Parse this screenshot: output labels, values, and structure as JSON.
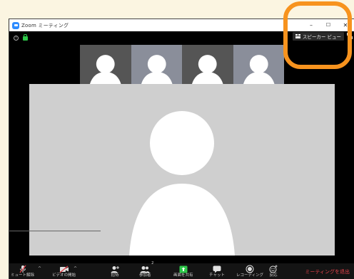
{
  "window": {
    "title": "Zoom ミーティング",
    "minimize_glyph": "–",
    "maximize_glyph": "☐",
    "close_glyph": "✕"
  },
  "header": {
    "info_glyph": "i",
    "speaker_view_label": "スピーカー ビュー"
  },
  "participants": {
    "thumbnails": [
      {
        "bg": "#555555"
      },
      {
        "bg": "#8a8e9a"
      },
      {
        "bg": "#555555"
      },
      {
        "bg": "#8a8e9a"
      }
    ],
    "main_bg": "#cfcfcf"
  },
  "toolbar": {
    "mute_label": "ミュート解除",
    "video_label": "ビデオの開始",
    "invite_label": "招待",
    "participants_label": "参加者",
    "participants_count": "2",
    "share_label": "画面を共有",
    "chat_label": "チャット",
    "record_label": "レコーディング",
    "reactions_label": "反応",
    "end_label": "ミーティングを退出",
    "caret_glyph": "^"
  },
  "colors": {
    "highlight": "#f7931e",
    "end_red": "#e8414b",
    "share_green": "#2ec84a",
    "zoom_blue": "#2d8cff"
  }
}
